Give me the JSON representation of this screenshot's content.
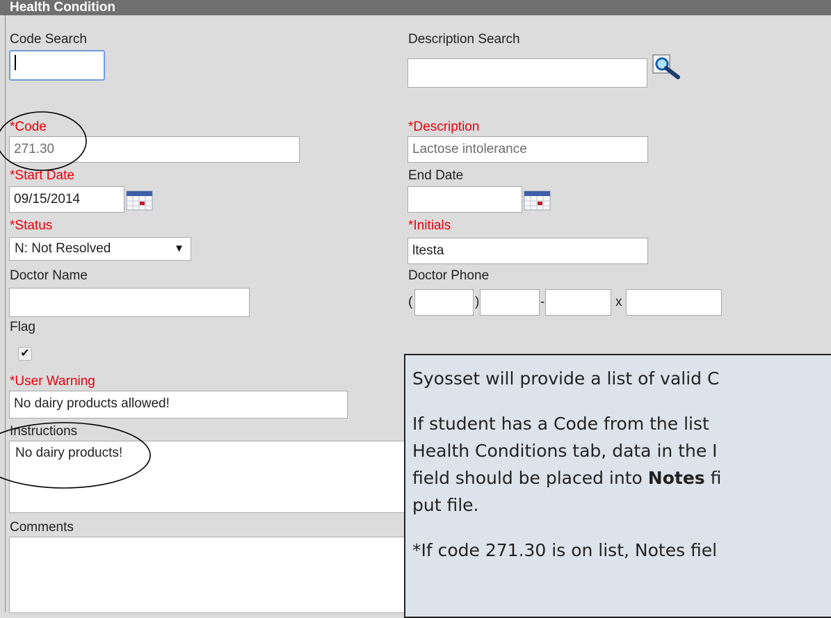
{
  "panel": {
    "title": "Health Condition"
  },
  "code_search": {
    "label": "Code Search",
    "value": ""
  },
  "description_search": {
    "label": "Description Search",
    "value": ""
  },
  "code": {
    "asterisk": "*",
    "label": "Code",
    "value": "271.30"
  },
  "description": {
    "asterisk": "*",
    "label": "Description",
    "value": "Lactose intolerance"
  },
  "start_date": {
    "asterisk": "*",
    "label": "Start Date",
    "value": "09/15/2014"
  },
  "end_date": {
    "label": "End Date",
    "value": ""
  },
  "status": {
    "asterisk": "*",
    "label": "Status",
    "value": "N: Not Resolved",
    "arrow": "▼"
  },
  "initials": {
    "asterisk": "*",
    "label": "Initials",
    "value": "ltesta"
  },
  "doctor_name": {
    "label": "Doctor Name",
    "value": ""
  },
  "doctor_phone": {
    "label": "Doctor Phone",
    "open_paren": "(",
    "close_paren": ")",
    "dash": "-",
    "ext": "x"
  },
  "flag": {
    "label": "Flag",
    "checked": true,
    "check_glyph": "✔"
  },
  "user_warning": {
    "asterisk": "*",
    "label": "User Warning",
    "value": "No dairy products allowed!"
  },
  "instructions": {
    "label": "Instructions",
    "value": "No dairy products!"
  },
  "comments": {
    "label": "Comments",
    "value": ""
  },
  "callout": {
    "line1": "Syosset will provide a list of valid C",
    "line2": "If student has a Code from the list",
    "line3": "Health Conditions tab, data in the I",
    "line4_pre": "field should be placed into ",
    "line4_bold": "Notes",
    "line4_post": " fi",
    "line5": "put file.",
    "line6": "*If code 271.30 is on list, Notes fiel"
  },
  "colors": {
    "required": "#e8000a",
    "title_bg": "#6f6f6f",
    "panel_bg": "#dcdcdc",
    "callout_bg": "#dde3ea"
  }
}
